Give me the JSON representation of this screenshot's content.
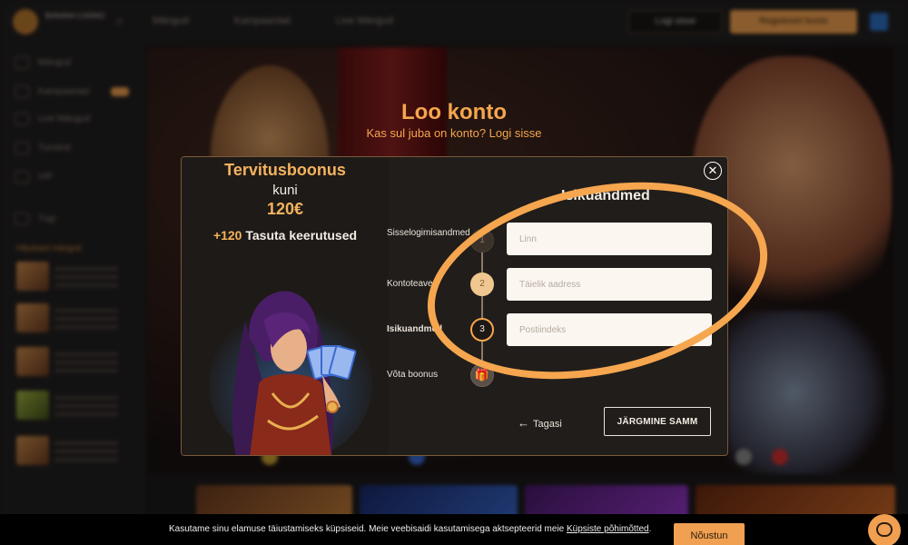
{
  "background": {
    "logo_text": "BANANA\nCASINO",
    "nav": [
      "Mängud",
      "Kampaaniad",
      "Live Mängud"
    ],
    "login_label": "Logi sisse",
    "register_label": "Registreeri konto",
    "sidebar_items": [
      "Mängud",
      "Kampaaniad",
      "Live Mängud",
      "Turniirid",
      "VIP",
      "Tugi"
    ],
    "recent_title": "Hiljutised mängud"
  },
  "modal": {
    "title": "Loo konto",
    "subtitle": "Kas sul juba on konto? Logi sisse",
    "promo": {
      "line1": "Tervitusboonus",
      "line2": "kuni",
      "line3": "120€",
      "spins_prefix": "+120",
      "spins_text": "Tasuta keerutused"
    },
    "section_title": "Isikuandmed",
    "steps": [
      {
        "label": "Sisselogimisandmed",
        "number": "1"
      },
      {
        "label": "Kontoteave",
        "number": "2"
      },
      {
        "label": "Isikuandmed",
        "number": "3"
      },
      {
        "label": "Võta boonus",
        "icon": "gift-icon"
      }
    ],
    "fields": {
      "city_placeholder": "Linn",
      "address_placeholder": "Täielik aadress",
      "postal_placeholder": "Postiindeks"
    },
    "back_label": "Tagasi",
    "next_label": "JÄRGMINE SAMM"
  },
  "cookie": {
    "text": "Kasutame sinu elamuse täiustamiseks küpsiseid. Meie veebisaidi kasutamisega aktsepteerid meie ",
    "link_text": "Küpsiste põhimõtted",
    "text_end": ".",
    "accept_label": "Nõustun"
  },
  "colors": {
    "accent": "#f5a64e",
    "modal_bg": "#211d1a",
    "field_bg": "#fbf6ef"
  }
}
